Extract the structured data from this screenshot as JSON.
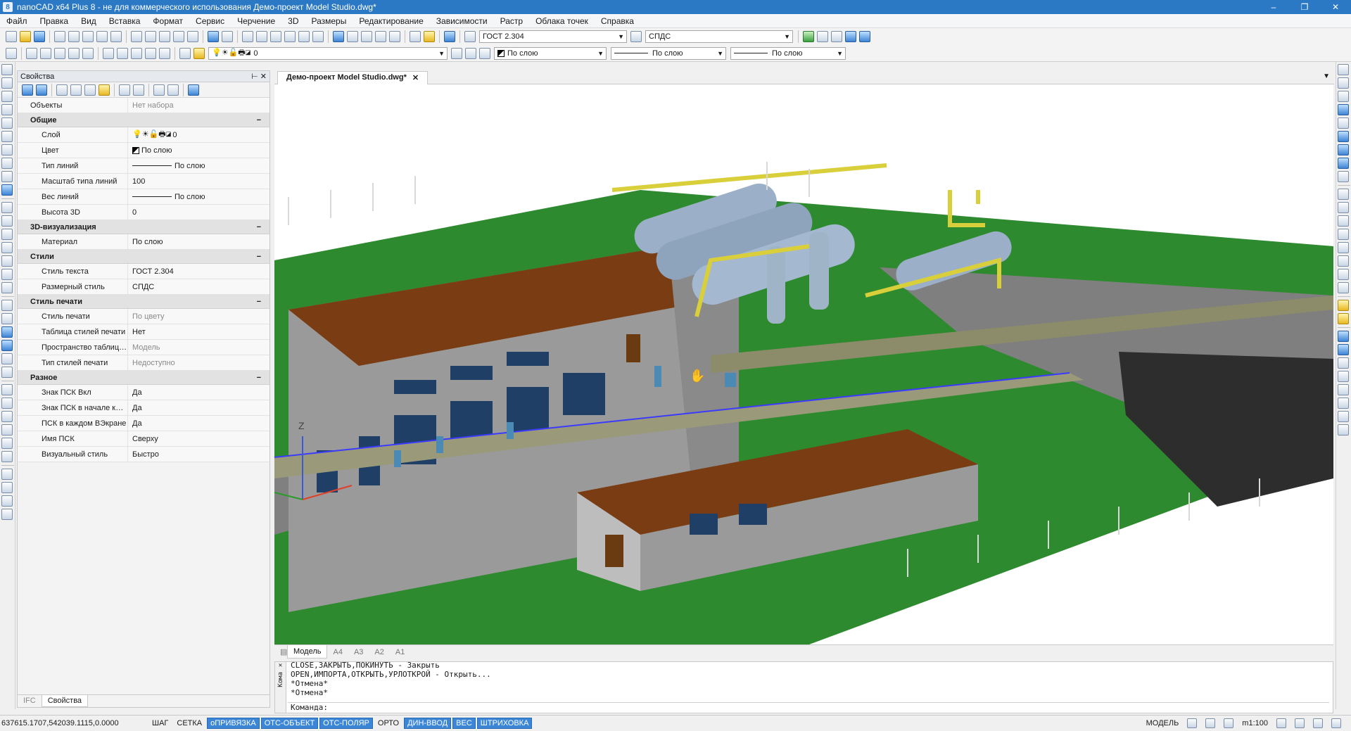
{
  "window": {
    "title": "nanoCAD x64 Plus 8 - не для коммерческого использования Демо-проект Model Studio.dwg*",
    "minimize": "–",
    "restore": "❐",
    "close": "✕"
  },
  "menu": [
    "Файл",
    "Правка",
    "Вид",
    "Вставка",
    "Формат",
    "Сервис",
    "Черчение",
    "3D",
    "Размеры",
    "Редактирование",
    "Зависимости",
    "Растр",
    "Облака точек",
    "Справка"
  ],
  "toolbar": {
    "text_style": "ГОСТ 2.304",
    "dim_style": "СПДС",
    "layer": "0",
    "color": "По слою",
    "linetype": "По слою",
    "lineweight": "По слою"
  },
  "panel": {
    "title": "Свойства",
    "objects_label": "Объекты",
    "objects_value": "Нет набора",
    "groups": [
      {
        "name": "Общие",
        "rows": [
          {
            "k": "Слой",
            "v": "0"
          },
          {
            "k": "Цвет",
            "v": "По слою"
          },
          {
            "k": "Тип линий",
            "v": "По слою"
          },
          {
            "k": "Масштаб типа линий",
            "v": "100"
          },
          {
            "k": "Вес линий",
            "v": "По слою"
          },
          {
            "k": "Высота 3D",
            "v": "0"
          }
        ]
      },
      {
        "name": "3D-визуализация",
        "rows": [
          {
            "k": "Материал",
            "v": "По слою"
          }
        ]
      },
      {
        "name": "Стили",
        "rows": [
          {
            "k": "Стиль текста",
            "v": "ГОСТ 2.304"
          },
          {
            "k": "Размерный стиль",
            "v": "СПДС"
          }
        ]
      },
      {
        "name": "Стиль печати",
        "rows": [
          {
            "k": "Стиль печати",
            "v": "По цвету",
            "dim": true
          },
          {
            "k": "Таблица стилей печати",
            "v": "Нет"
          },
          {
            "k": "Пространство таблицы ...",
            "v": "Модель",
            "dim": true
          },
          {
            "k": "Тип стилей печати",
            "v": "Недоступно",
            "dim": true
          }
        ]
      },
      {
        "name": "Разное",
        "rows": [
          {
            "k": "Знак ПСК Вкл",
            "v": "Да"
          },
          {
            "k": "Знак ПСК в начале коо...",
            "v": "Да"
          },
          {
            "k": "ПСК в каждом ВЭкране",
            "v": "Да"
          },
          {
            "k": "Имя ПСК",
            "v": "Сверху"
          },
          {
            "k": "Визуальный стиль",
            "v": "Быстро"
          }
        ]
      }
    ],
    "tabs": [
      "IFC",
      "Свойства"
    ]
  },
  "doc_tab": "Демо-проект Model Studio.dwg*",
  "layout_tabs": [
    "Модель",
    "A4",
    "A3",
    "A2",
    "A1"
  ],
  "command": {
    "side": "Кома",
    "lines": [
      "CLOSE,ЗАКРЫТЬ,ПОКИНУТЬ - Закрыть",
      "OPEN,ИМПОРТА,ОТКРЫТЬ,УРЛОТКРОЙ - Открыть...",
      "*Отмена*",
      "*Отмена*"
    ],
    "prompt": "Команда:"
  },
  "status": {
    "coords": "637615.1707,542039.1115,0.0000",
    "buttons": [
      {
        "l": "ШАГ",
        "on": false
      },
      {
        "l": "СЕТКА",
        "on": false
      },
      {
        "l": "оПРИВЯЗКА",
        "on": true
      },
      {
        "l": "ОТС-ОБЪЕКТ",
        "on": true
      },
      {
        "l": "ОТС-ПОЛЯР",
        "on": true
      },
      {
        "l": "ОРТО",
        "on": false
      },
      {
        "l": "ДИН-ВВОД",
        "on": true
      },
      {
        "l": "ВЕС",
        "on": true
      },
      {
        "l": "ШТРИХОВКА",
        "on": true
      }
    ],
    "mode": "МОДЕЛЬ",
    "scale": "m1:100"
  },
  "axis": {
    "z": "Z"
  }
}
